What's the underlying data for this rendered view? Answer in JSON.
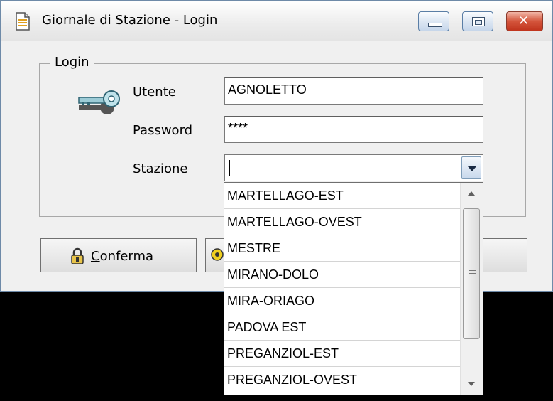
{
  "window": {
    "title": "Giornale di Stazione - Login"
  },
  "login": {
    "group_label": "Login",
    "user_label": "Utente",
    "user_value": "AGNOLETTO",
    "password_label": "Password",
    "password_value": "****",
    "station_label": "Stazione",
    "station_value": ""
  },
  "buttons": {
    "confirm_label": "Conferma"
  },
  "dropdown": {
    "options": [
      "MARTELLAGO-EST",
      "MARTELLAGO-OVEST",
      "MESTRE",
      "MIRANO-DOLO",
      "MIRA-ORIAGO",
      "PADOVA EST",
      "PREGANZIOL-EST",
      "PREGANZIOL-OVEST"
    ]
  }
}
